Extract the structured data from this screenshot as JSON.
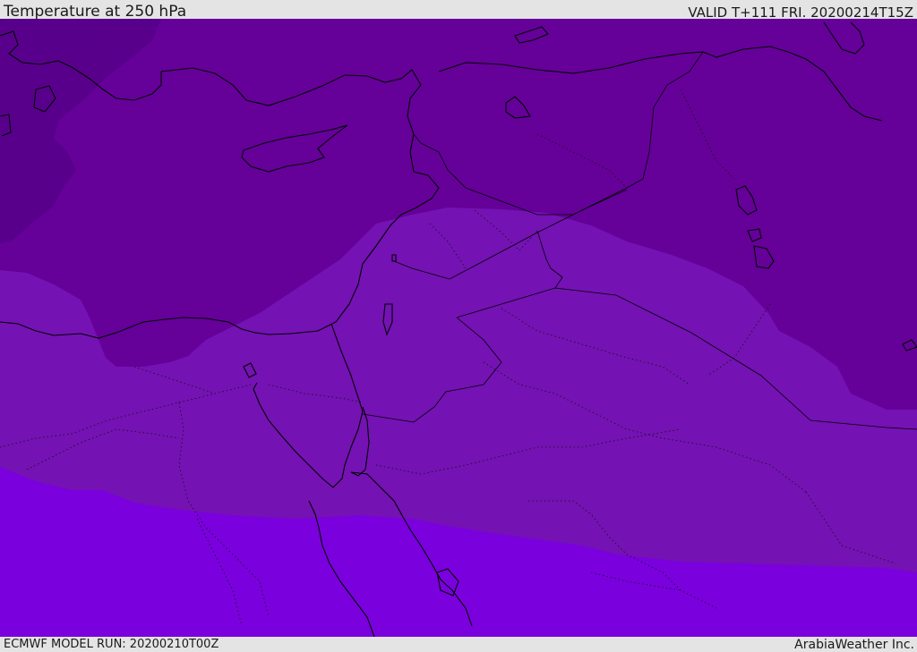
{
  "header": {
    "title": "Temperature at 250 hPa",
    "valid": "VALID T+111 FRI. 20200214T15Z"
  },
  "footer": {
    "model_run": "ECMWF MODEL RUN: 20200210T00Z",
    "credit": "ArabiaWeather Inc."
  },
  "colors": {
    "band_darkest": "#58008c",
    "band_dark": "#650099",
    "band_mid": "#7412b3",
    "band_light": "#7a00dd",
    "coastline": "#000000",
    "bar_background": "#e4e4e4"
  }
}
